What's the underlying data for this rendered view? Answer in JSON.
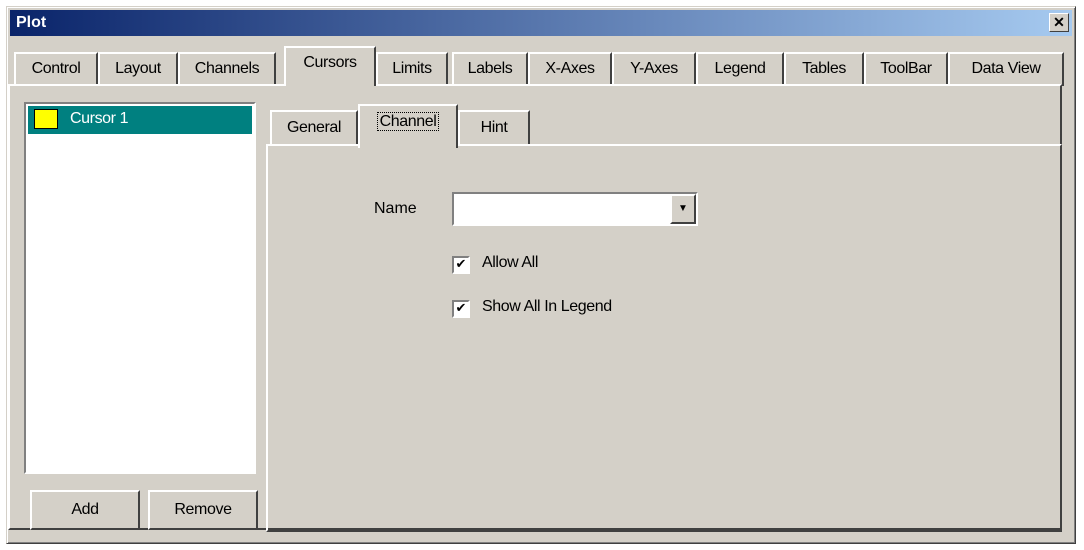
{
  "window": {
    "title": "Plot",
    "close_symbol": "✕"
  },
  "tabs": [
    {
      "label": "Control"
    },
    {
      "label": "Layout"
    },
    {
      "label": "Channels"
    },
    {
      "label": "Cursors"
    },
    {
      "label": "Limits"
    },
    {
      "label": "Labels"
    },
    {
      "label": "X-Axes"
    },
    {
      "label": "Y-Axes"
    },
    {
      "label": "Legend"
    },
    {
      "label": "Tables"
    },
    {
      "label": "ToolBar"
    },
    {
      "label": "Data View"
    }
  ],
  "active_tab": "Cursors",
  "cursor_list": {
    "items": [
      {
        "label": "Cursor 1",
        "color": "#ffff00",
        "selected": true
      }
    ],
    "selection_color": "#008080"
  },
  "buttons": {
    "add": "Add",
    "remove": "Remove"
  },
  "subtabs": [
    {
      "label": "General"
    },
    {
      "label": "Channel"
    },
    {
      "label": "Hint"
    }
  ],
  "active_subtab": "Channel",
  "channel": {
    "name_label": "Name",
    "name_value": "",
    "dropdown_arrow": "▼",
    "allow_all": {
      "label": "Allow All",
      "checked": true,
      "mark": "✔"
    },
    "show_all_in_legend": {
      "label": "Show All In Legend",
      "checked": true,
      "mark": "✔"
    }
  }
}
